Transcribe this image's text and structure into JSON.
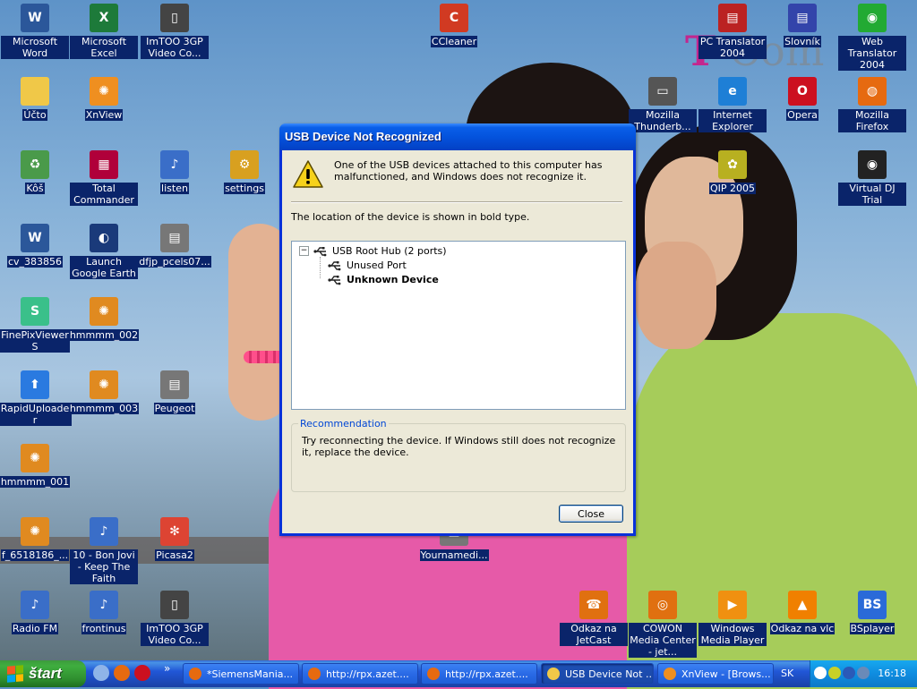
{
  "desktop": {
    "icons": [
      {
        "label": "Microsoft Word",
        "icon": "word-icon",
        "color": "#2b579a",
        "glyph": "W"
      },
      {
        "label": "Microsoft Excel",
        "icon": "excel-icon",
        "color": "#1d7a3a",
        "glyph": "X"
      },
      {
        "label": "ImTOO 3GP Video Co...",
        "icon": "phone-icon",
        "color": "#444",
        "glyph": "▯"
      },
      {
        "label": "CCleaner",
        "icon": "ccleaner-icon",
        "color": "#d13a22",
        "glyph": "C"
      },
      {
        "label": "PC Translator 2004",
        "icon": "translator-icon",
        "color": "#b22",
        "glyph": "▤"
      },
      {
        "label": "Slovník",
        "icon": "dictionary-icon",
        "color": "#3344aa",
        "glyph": "▤"
      },
      {
        "label": "Web Translator 2004",
        "icon": "web-translator-icon",
        "color": "#22aa33",
        "glyph": "◉"
      },
      {
        "label": "Účto",
        "icon": "folder-icon",
        "color": "#f0c848",
        "glyph": ""
      },
      {
        "label": "XnView",
        "icon": "xnview-icon",
        "color": "#ef8f20",
        "glyph": "✺"
      },
      {
        "label": "Mozilla Thunderb...",
        "icon": "thunderbird-icon",
        "color": "#555",
        "glyph": "▭"
      },
      {
        "label": "Internet Explorer",
        "icon": "ie-icon",
        "color": "#1e7fd6",
        "glyph": "e"
      },
      {
        "label": "Opera",
        "icon": "opera-icon",
        "color": "#cc1020",
        "glyph": "O"
      },
      {
        "label": "Mozilla Firefox",
        "icon": "firefox-icon",
        "color": "#e66a10",
        "glyph": "◍"
      },
      {
        "label": "Kôš",
        "icon": "recycle-bin-icon",
        "color": "#4a9a4a",
        "glyph": "♻"
      },
      {
        "label": "Total Commander",
        "icon": "total-commander-icon",
        "color": "#b0003a",
        "glyph": "▦"
      },
      {
        "label": "listen",
        "icon": "audio-file-icon",
        "color": "#3a6ec8",
        "glyph": "♪"
      },
      {
        "label": "settings",
        "icon": "settings-file-icon",
        "color": "#d8a020",
        "glyph": "⚙"
      },
      {
        "label": "QIP 2005",
        "icon": "qip-icon",
        "color": "#b8b020",
        "glyph": "✿"
      },
      {
        "label": "Virtual DJ Trial",
        "icon": "virtual-dj-icon",
        "color": "#222",
        "glyph": "◉"
      },
      {
        "label": "cv_383856",
        "icon": "word-document-icon",
        "color": "#2b579a",
        "glyph": "W"
      },
      {
        "label": "Launch Google Earth",
        "icon": "google-earth-icon",
        "color": "#1a3a7a",
        "glyph": "◐"
      },
      {
        "label": "dfjp_pcels07...",
        "icon": "document-icon",
        "color": "#777",
        "glyph": "▤"
      },
      {
        "label": "FinePixViewer S",
        "icon": "finepix-icon",
        "color": "#3ac08a",
        "glyph": "S"
      },
      {
        "label": "hmmmm_002",
        "icon": "jpg-file-icon",
        "color": "#e08a20",
        "glyph": "✺"
      },
      {
        "label": "RapidUploader",
        "icon": "upload-arrow-icon",
        "color": "#2a7ae0",
        "glyph": "⬆"
      },
      {
        "label": "hmmmm_003",
        "icon": "jpg-file-icon",
        "color": "#e08a20",
        "glyph": "✺"
      },
      {
        "label": "Peugeot",
        "icon": "document-icon",
        "color": "#777",
        "glyph": "▤"
      },
      {
        "label": "hmmmm_001",
        "icon": "jpg-file-icon",
        "color": "#e08a20",
        "glyph": "✺"
      },
      {
        "label": "f_6518186_...",
        "icon": "jpg-file-icon",
        "color": "#e08a20",
        "glyph": "✺"
      },
      {
        "label": "10 - Bon Jovi - Keep The Faith",
        "icon": "audio-file-icon",
        "color": "#3a6ec8",
        "glyph": "♪"
      },
      {
        "label": "Picasa2",
        "icon": "picasa-icon",
        "color": "#d43",
        "glyph": "✻"
      },
      {
        "label": "Yournamedi...",
        "icon": "document-icon",
        "color": "#777",
        "glyph": "▤"
      },
      {
        "label": "Radio FM",
        "icon": "audio-file-icon",
        "color": "#3a6ec8",
        "glyph": "♪"
      },
      {
        "label": "frontinus",
        "icon": "audio-file-icon",
        "color": "#3a6ec8",
        "glyph": "♪"
      },
      {
        "label": "ImTOO 3GP Video Co...",
        "icon": "phone-icon",
        "color": "#444",
        "glyph": "▯"
      },
      {
        "label": "Odkaz na JetCast",
        "icon": "jetcast-icon",
        "color": "#e07010",
        "glyph": "☎"
      },
      {
        "label": "COWON Media Center - jet...",
        "icon": "cowon-icon",
        "color": "#e07010",
        "glyph": "◎"
      },
      {
        "label": "Windows Media Player",
        "icon": "media-player-icon",
        "color": "#f09010",
        "glyph": "▶"
      },
      {
        "label": "Odkaz na vlc",
        "icon": "vlc-icon",
        "color": "#f08000",
        "glyph": "▲"
      },
      {
        "label": "BSplayer",
        "icon": "bsplayer-icon",
        "color": "#2a6ad8",
        "glyph": "BS"
      }
    ],
    "wallpaper_logo": {
      "t": "T",
      "rest": "·Com"
    }
  },
  "dialog": {
    "title": "USB Device Not Recognized",
    "message": "One of the USB devices attached to this computer has malfunctioned, and Windows does not recognize it.",
    "location_note": "The location of the device is shown in bold type.",
    "tree": {
      "expander": "−",
      "root": "USB Root Hub (2 ports)",
      "children": [
        "Unused Port",
        "Unknown Device"
      ]
    },
    "recommendation_title": "Recommendation",
    "recommendation_text": "Try reconnecting the device. If Windows still does not recognize it, replace the device.",
    "close_label": "Close"
  },
  "taskbar": {
    "start_label": "štart",
    "quick_launch": [
      {
        "icon": "show-desktop-icon",
        "color": "#8fb4e8"
      },
      {
        "icon": "firefox-icon",
        "color": "#e66a10"
      },
      {
        "icon": "opera-icon",
        "color": "#cc1020"
      }
    ],
    "overflow_chevron": "»",
    "buttons": [
      {
        "label": "*SiemensMania...",
        "icon": "firefox-icon",
        "color": "#e66a10",
        "active": false
      },
      {
        "label": "http://rpx.azet....",
        "icon": "firefox-icon",
        "color": "#e66a10",
        "active": false
      },
      {
        "label": "http://rpx.azet....",
        "icon": "firefox-icon",
        "color": "#e66a10",
        "active": false
      },
      {
        "label": "USB Device Not ...",
        "icon": "folder-icon",
        "color": "#f0c848",
        "active": true
      },
      {
        "label": "XnView - [Brows...",
        "icon": "xnview-icon",
        "color": "#ef8f20",
        "active": false
      }
    ],
    "language": "SK",
    "tray_icons": [
      {
        "icon": "collapse-arrow-icon",
        "color": "#ffffff"
      },
      {
        "icon": "qip-tray-icon",
        "color": "#c8d028"
      },
      {
        "icon": "network-globe-icon",
        "color": "#2a5ab8"
      },
      {
        "icon": "usb-tray-icon",
        "color": "#6a8ab8"
      }
    ],
    "clock": "16:18"
  }
}
